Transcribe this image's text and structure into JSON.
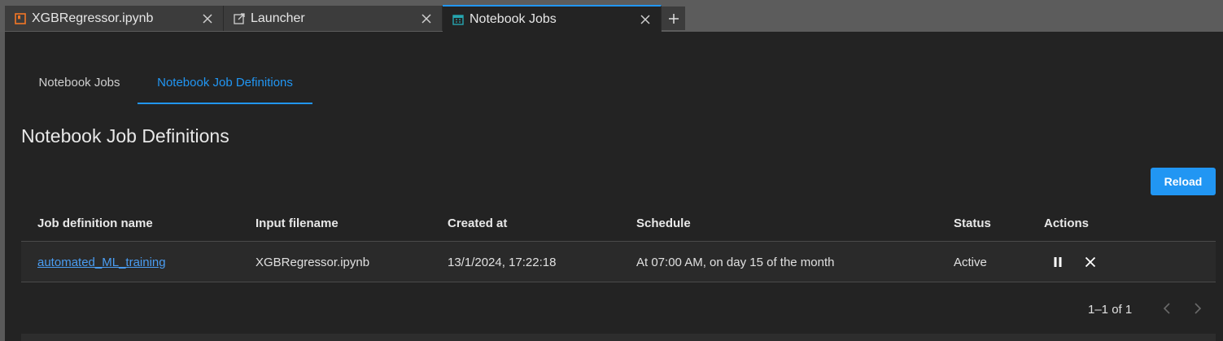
{
  "tabs": [
    {
      "label": "XGBRegressor.ipynb",
      "icon": "notebook-icon",
      "color": "#f37626"
    },
    {
      "label": "Launcher",
      "icon": "launch-icon"
    },
    {
      "label": "Notebook Jobs",
      "icon": "calendar-icon",
      "color": "#26a6b0"
    }
  ],
  "subtabs": {
    "jobs": "Notebook Jobs",
    "definitions": "Notebook Job Definitions"
  },
  "page_title": "Notebook Job Definitions",
  "reload_label": "Reload",
  "table": {
    "headers": [
      "Job definition name",
      "Input filename",
      "Created at",
      "Schedule",
      "Status",
      "Actions"
    ],
    "rows": [
      {
        "name": "automated_ML_training",
        "input": "XGBRegressor.ipynb",
        "created": "13/1/2024, 17:22:18",
        "schedule": "At 07:00 AM, on day 15 of the month",
        "status": "Active"
      }
    ]
  },
  "pagination": "1–1 of 1",
  "colors": {
    "accent": "#2196f3",
    "link": "#4a9df2",
    "background": "#232323"
  }
}
